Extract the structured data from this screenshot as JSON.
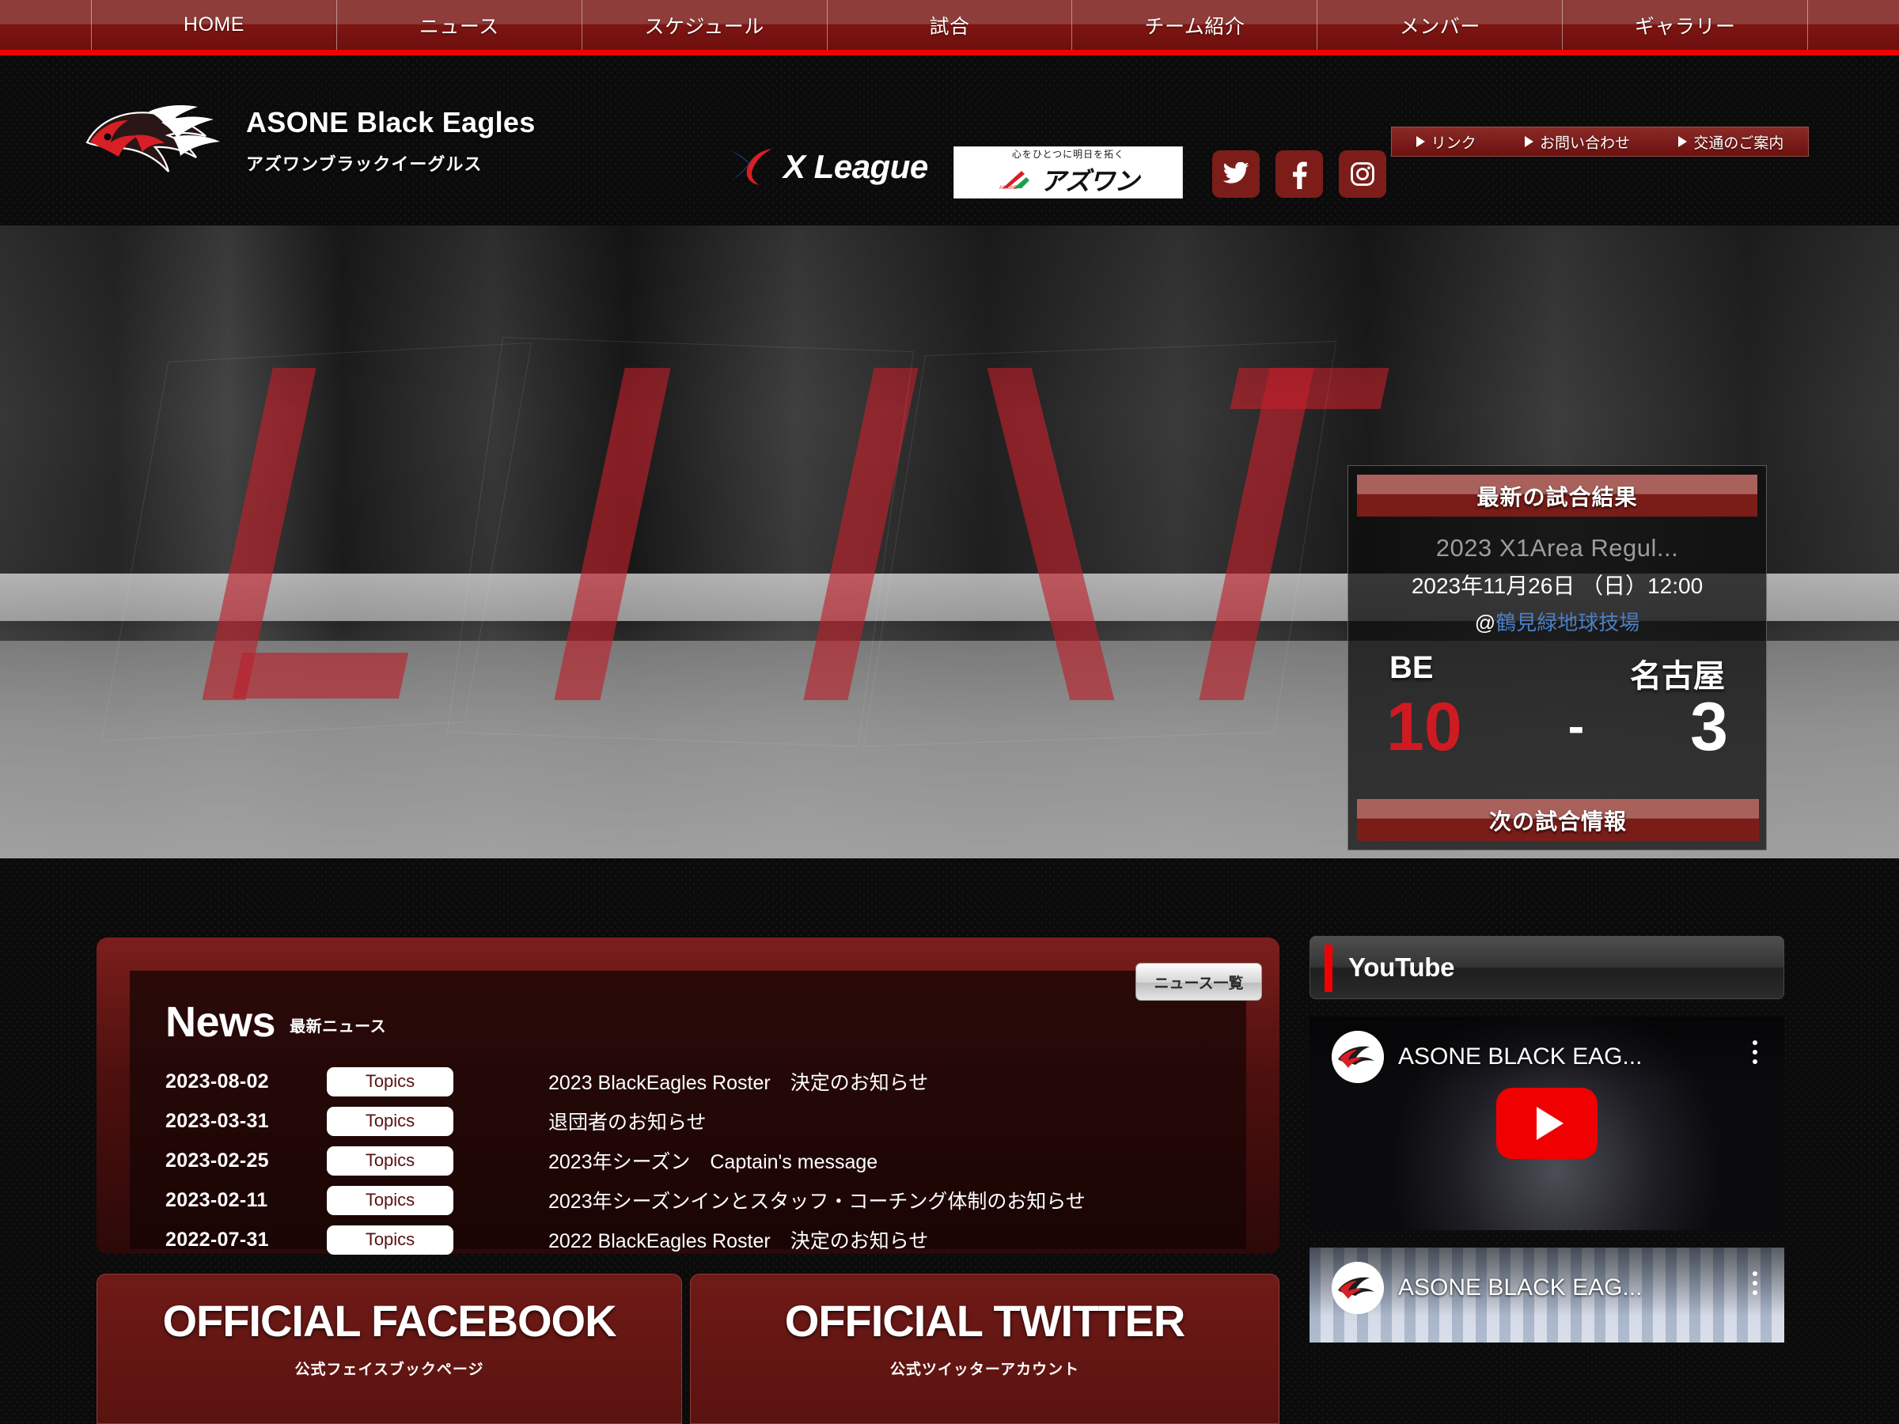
{
  "globalnav": {
    "items": [
      {
        "label": "HOME"
      },
      {
        "label": "ニュース"
      },
      {
        "label": "スケジュール"
      },
      {
        "label": "試合"
      },
      {
        "label": "チーム紹介"
      },
      {
        "label": "メンバー"
      },
      {
        "label": "ギャラリー"
      }
    ]
  },
  "header": {
    "brand_en": "ASONE Black Eagles",
    "brand_ja": "アズワンブラックイーグルス",
    "xleague_label": "X League",
    "sponsor": {
      "tagline": "心をひとつに明日を拓く",
      "name": "アズワン",
      "mark": "AS ONE"
    },
    "social": [
      {
        "name": "twitter",
        "glyph": "twitter-icon"
      },
      {
        "name": "facebook",
        "glyph": "facebook-icon"
      },
      {
        "name": "instagram",
        "glyph": "instagram-icon"
      }
    ],
    "utility": [
      {
        "label": "リンク"
      },
      {
        "label": "お問い合わせ"
      },
      {
        "label": "交通のご案内"
      }
    ]
  },
  "hero": {
    "result_panel": {
      "title": "最新の試合結果",
      "league": "2023 X1Area Regul...",
      "datetime": "2023年11月26日 （日）12:00",
      "venue_prefix": "@",
      "venue": "鶴見緑地球技場",
      "home_team": "BE",
      "away_team": "名古屋",
      "home_score": "10",
      "dash": "-",
      "away_score": "3",
      "next_match_label": "次の試合情報",
      "home_score_color": "#d01a22"
    }
  },
  "news": {
    "heading_en": "News",
    "heading_ja": "最新ニュース",
    "list_button": "ニュース一覧",
    "rows": [
      {
        "date": "2023-08-02",
        "category": "Topics",
        "title": "2023 BlackEagles Roster　決定のお知らせ"
      },
      {
        "date": "2023-03-31",
        "category": "Topics",
        "title": "退団者のお知らせ"
      },
      {
        "date": "2023-02-25",
        "category": "Topics",
        "title": "2023年シーズン　Captain's message"
      },
      {
        "date": "2023-02-11",
        "category": "Topics",
        "title": "2023年シーズンインとスタッフ・コーチング体制のお知らせ"
      },
      {
        "date": "2022-07-31",
        "category": "Topics",
        "title": "2022 BlackEagles Roster　決定のお知らせ"
      }
    ]
  },
  "sns_banners": {
    "facebook": {
      "title": "OFFICIAL FACEBOOK",
      "subtitle": "公式フェイスブックページ"
    },
    "twitter": {
      "title": "OFFICIAL TWITTER",
      "subtitle": "公式ツイッターアカウント"
    }
  },
  "youtube": {
    "title": "YouTube",
    "accent_color": "#f00000",
    "videos": [
      {
        "channel": "ASONE BLACK EAG..."
      },
      {
        "channel": "ASONE BLACK EAG..."
      }
    ]
  }
}
